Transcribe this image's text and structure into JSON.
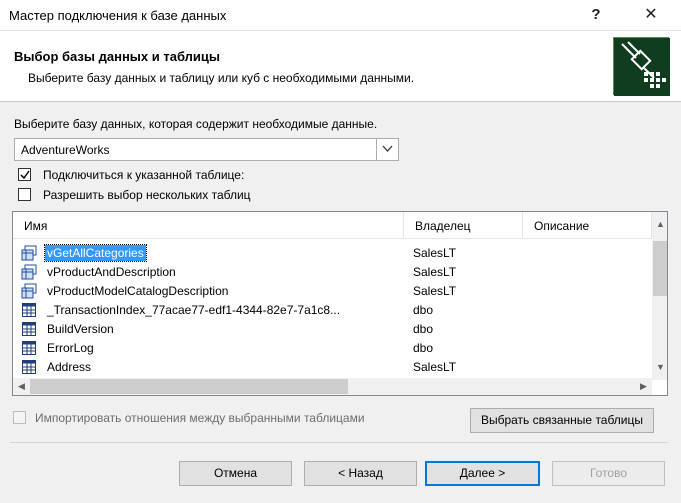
{
  "window": {
    "title": "Мастер подключения к базе данных",
    "help_glyph": "?",
    "close_glyph": "✕"
  },
  "header": {
    "title": "Выбор базы данных и таблицы",
    "subtitle": "Выберите базу данных и таблицу или куб с необходимыми данными.",
    "icon": "connector-plug-icon"
  },
  "database": {
    "label": "Выберите базу данных, которая содержит необходимые данные.",
    "selected": "AdventureWorks"
  },
  "options": {
    "connect_table_label": "Подключиться к указанной таблице:",
    "connect_table_checked": true,
    "multi_select_label": "Разрешить выбор нескольких таблиц",
    "multi_select_checked": false
  },
  "table": {
    "columns": [
      "Имя",
      "Владелец",
      "Описание"
    ],
    "rows": [
      {
        "name": "vGetAllCategories",
        "owner": "SalesLT",
        "type": "view",
        "selected": true
      },
      {
        "name": "vProductAndDescription",
        "owner": "SalesLT",
        "type": "view"
      },
      {
        "name": "vProductModelCatalogDescription",
        "owner": "SalesLT",
        "type": "view"
      },
      {
        "name": "_TransactionIndex_77acae77-edf1-4344-82e7-7a1c8...",
        "owner": "dbo",
        "type": "table"
      },
      {
        "name": "BuildVersion",
        "owner": "dbo",
        "type": "table"
      },
      {
        "name": "ErrorLog",
        "owner": "dbo",
        "type": "table"
      },
      {
        "name": "Address",
        "owner": "SalesLT",
        "type": "table"
      }
    ]
  },
  "import_relations": {
    "label": "Импортировать отношения между выбранными таблицами",
    "checked": false,
    "enabled": false
  },
  "buttons": {
    "select_related": "Выбрать связанные таблицы",
    "cancel": "Отмена",
    "back": "< Назад",
    "next": "Далее >",
    "finish": "Готово"
  },
  "colors": {
    "accent": "#0078d7",
    "selection": "#3399ff"
  }
}
